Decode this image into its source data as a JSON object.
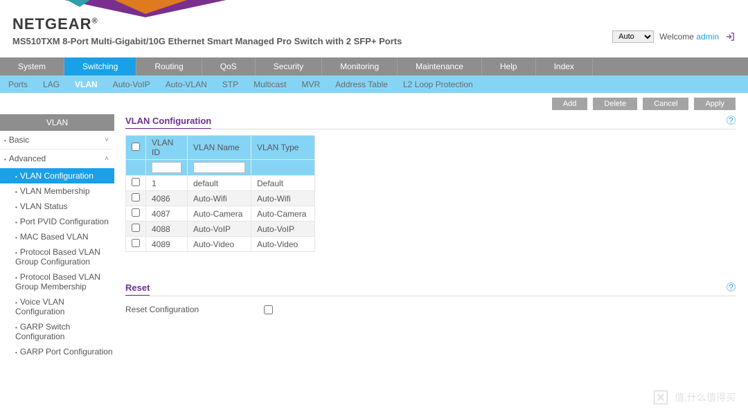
{
  "brand": {
    "name": "NETGEAR",
    "reg": "®"
  },
  "model": "MS510TXM 8-Port Multi-Gigabit/10G Ethernet Smart Managed Pro Switch with 2 SFP+ Ports",
  "header": {
    "lang_selected": "Auto",
    "lang_options": [
      "Auto"
    ],
    "welcome": "Welcome",
    "user": "admin"
  },
  "main_nav": {
    "items": [
      "System",
      "Switching",
      "Routing",
      "QoS",
      "Security",
      "Monitoring",
      "Maintenance",
      "Help",
      "Index"
    ],
    "active_index": 1
  },
  "sub_nav": {
    "items": [
      "Ports",
      "LAG",
      "VLAN",
      "Auto-VoIP",
      "Auto-VLAN",
      "STP",
      "Multicast",
      "MVR",
      "Address Table",
      "L2 Loop Protection"
    ],
    "active_index": 2
  },
  "actions": [
    "Add",
    "Delete",
    "Cancel",
    "Apply"
  ],
  "sidebar": {
    "title": "VLAN",
    "groups": [
      {
        "label": "Basic",
        "expanded": false
      },
      {
        "label": "Advanced",
        "expanded": true,
        "children": [
          "VLAN Configuration",
          "VLAN Membership",
          "VLAN Status",
          "Port PVID Configuration",
          "MAC Based VLAN",
          "Protocol Based VLAN Group Configuration",
          "Protocol Based VLAN Group Membership",
          "Voice VLAN Configuration",
          "GARP Switch Configuration",
          "GARP Port Configuration"
        ],
        "selected_index": 0
      }
    ]
  },
  "panel": {
    "title": "VLAN Configuration",
    "columns": [
      "VLAN ID",
      "VLAN Name",
      "VLAN Type"
    ],
    "rows": [
      {
        "id": "1",
        "name": "default",
        "type": "Default"
      },
      {
        "id": "4086",
        "name": "Auto-Wifi",
        "type": "Auto-Wifi"
      },
      {
        "id": "4087",
        "name": "Auto-Camera",
        "type": "Auto-Camera"
      },
      {
        "id": "4088",
        "name": "Auto-VoIP",
        "type": "Auto-VoIP"
      },
      {
        "id": "4089",
        "name": "Auto-Video",
        "type": "Auto-Video"
      }
    ]
  },
  "reset": {
    "title": "Reset",
    "label": "Reset Configuration"
  },
  "watermark": "值,什么值得买"
}
